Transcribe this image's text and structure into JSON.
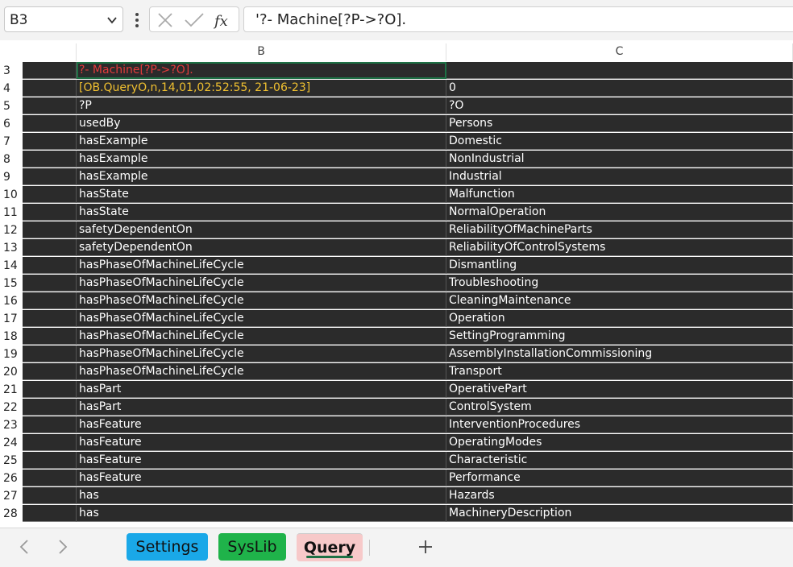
{
  "formula_bar": {
    "name_box": "B3",
    "formula": "'?- Machine[?P->?O]."
  },
  "columns": [
    "B",
    "C"
  ],
  "rows": [
    {
      "n": "3",
      "b": "?- Machine[?P->?O].",
      "c": "",
      "style": "red"
    },
    {
      "n": "4",
      "b": "[OB.QueryO,n,14,01,02:52:55, 21-06-23]",
      "c": "0",
      "style": "yellow"
    },
    {
      "n": "5",
      "b": "?P",
      "c": "?O"
    },
    {
      "n": "6",
      "b": "usedBy",
      "c": "Persons"
    },
    {
      "n": "7",
      "b": "hasExample",
      "c": "Domestic"
    },
    {
      "n": "8",
      "b": "hasExample",
      "c": "NonIndustrial"
    },
    {
      "n": "9",
      "b": "hasExample",
      "c": "Industrial"
    },
    {
      "n": "10",
      "b": "hasState",
      "c": "Malfunction"
    },
    {
      "n": "11",
      "b": "hasState",
      "c": "NormalOperation"
    },
    {
      "n": "12",
      "b": "safetyDependentOn",
      "c": "ReliabilityOfMachineParts"
    },
    {
      "n": "13",
      "b": "safetyDependentOn",
      "c": "ReliabilityOfControlSystems"
    },
    {
      "n": "14",
      "b": "hasPhaseOfMachineLifeCycle",
      "c": "Dismantling"
    },
    {
      "n": "15",
      "b": "hasPhaseOfMachineLifeCycle",
      "c": "Troubleshooting"
    },
    {
      "n": "16",
      "b": "hasPhaseOfMachineLifeCycle",
      "c": "CleaningMaintenance"
    },
    {
      "n": "17",
      "b": "hasPhaseOfMachineLifeCycle",
      "c": "Operation"
    },
    {
      "n": "18",
      "b": "hasPhaseOfMachineLifeCycle",
      "c": "SettingProgramming"
    },
    {
      "n": "19",
      "b": "hasPhaseOfMachineLifeCycle",
      "c": "AssemblyInstallationCommissioning"
    },
    {
      "n": "20",
      "b": "hasPhaseOfMachineLifeCycle",
      "c": "Transport"
    },
    {
      "n": "21",
      "b": "hasPart",
      "c": "OperativePart"
    },
    {
      "n": "22",
      "b": "hasPart",
      "c": "ControlSystem"
    },
    {
      "n": "23",
      "b": "hasFeature",
      "c": "InterventionProcedures"
    },
    {
      "n": "24",
      "b": "hasFeature",
      "c": "OperatingModes"
    },
    {
      "n": "25",
      "b": "hasFeature",
      "c": "Characteristic"
    },
    {
      "n": "26",
      "b": "hasFeature",
      "c": "Performance"
    },
    {
      "n": "27",
      "b": "has",
      "c": "Hazards"
    },
    {
      "n": "28",
      "b": "has",
      "c": "MachineryDescription"
    }
  ],
  "sheet_tabs": {
    "settings": "Settings",
    "syslib": "SysLib",
    "query": "Query"
  },
  "icons": {
    "name_box_dropdown": "chevron-down-icon",
    "more": "vertical-dots-icon",
    "cancel": "close-icon",
    "enter": "check-icon",
    "function": "fx-icon",
    "prev_sheet": "chevron-left-icon",
    "next_sheet": "chevron-right-icon",
    "add_sheet": "plus-icon"
  },
  "colors": {
    "cell_background": "#2b2b2b",
    "query_text": "#e23b3b",
    "status_text": "#f0c030",
    "settings_tab": "#1aa8e8",
    "syslib_tab": "#1fb34a",
    "query_tab": "#f7c9c9"
  }
}
